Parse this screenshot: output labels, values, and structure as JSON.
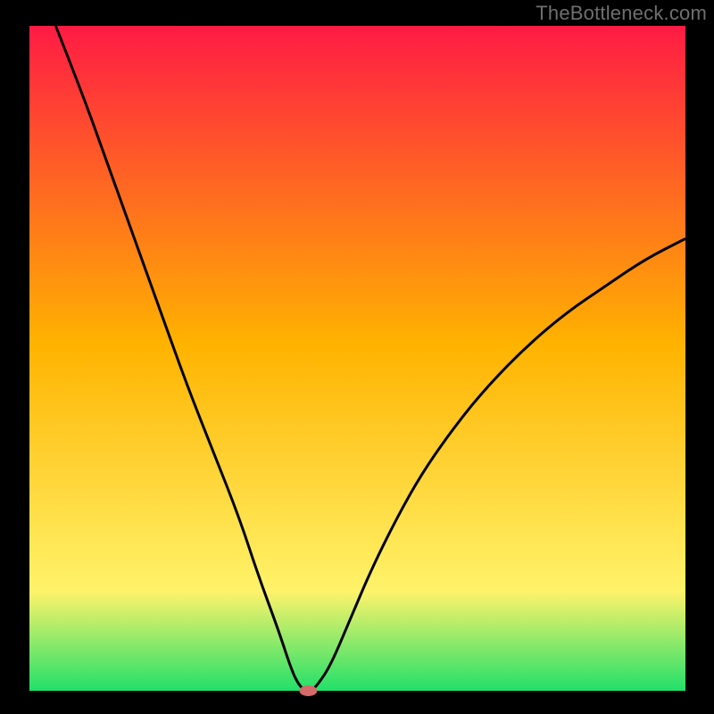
{
  "watermark": "TheBottleneck.com",
  "palette": {
    "frame_black": "#000000",
    "curve_black": "#000000",
    "marker_pink": "#d46a6a",
    "grad_top": "#ff1b44",
    "grad_mid": "#ffb300",
    "grad_low": "#fff36a",
    "grad_bottom": "#21e06a"
  },
  "chart_data": {
    "type": "line",
    "title": "",
    "xlabel": "",
    "ylabel": "",
    "xlim": [
      0,
      100
    ],
    "ylim": [
      0,
      100
    ],
    "axes_visible": false,
    "background": "rainbow-vertical-gradient",
    "curve": {
      "description": "V-shaped bottleneck curve with minimum near x≈42",
      "points": [
        [
          4,
          100
        ],
        [
          8,
          90
        ],
        [
          12,
          79
        ],
        [
          16,
          68
        ],
        [
          20,
          57
        ],
        [
          24,
          46
        ],
        [
          28,
          36
        ],
        [
          32,
          26
        ],
        [
          35,
          17
        ],
        [
          38,
          9
        ],
        [
          40,
          3
        ],
        [
          41,
          1
        ],
        [
          42,
          0
        ],
        [
          43,
          0
        ],
        [
          44,
          1
        ],
        [
          46,
          4
        ],
        [
          49,
          11
        ],
        [
          52,
          18
        ],
        [
          56,
          26
        ],
        [
          60,
          33
        ],
        [
          65,
          40
        ],
        [
          70,
          46
        ],
        [
          76,
          52
        ],
        [
          82,
          57
        ],
        [
          88,
          61
        ],
        [
          94,
          65
        ],
        [
          100,
          68
        ]
      ]
    },
    "marker": {
      "x": 42.5,
      "y": 0,
      "color": "#d46a6a",
      "radius_pct": 0.9
    }
  }
}
